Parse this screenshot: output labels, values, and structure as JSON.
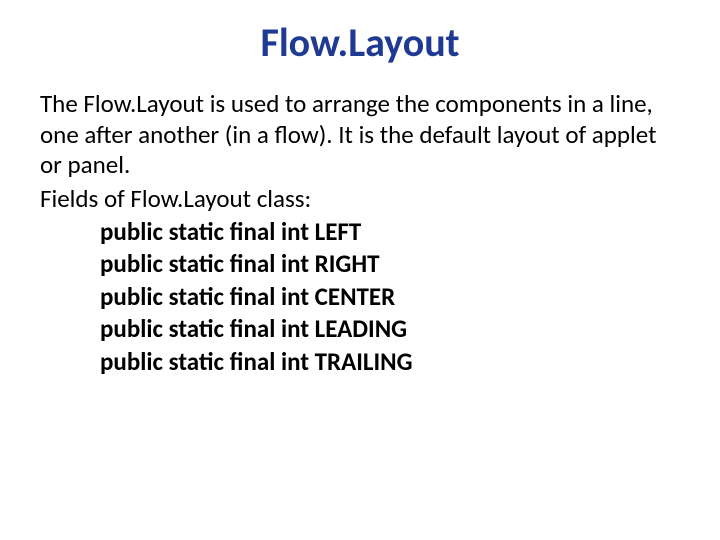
{
  "title": "Flow.Layout",
  "description": "The Flow.Layout is used to arrange the components in a line, one after another (in a flow). It is the default layout of applet or panel.",
  "fields_label": "Fields of Flow.Layout class:",
  "fields": [
    "public static final int LEFT",
    "public static final int RIGHT",
    "public static final int CENTER",
    "public static final int LEADING",
    "public static final int TRAILING"
  ]
}
